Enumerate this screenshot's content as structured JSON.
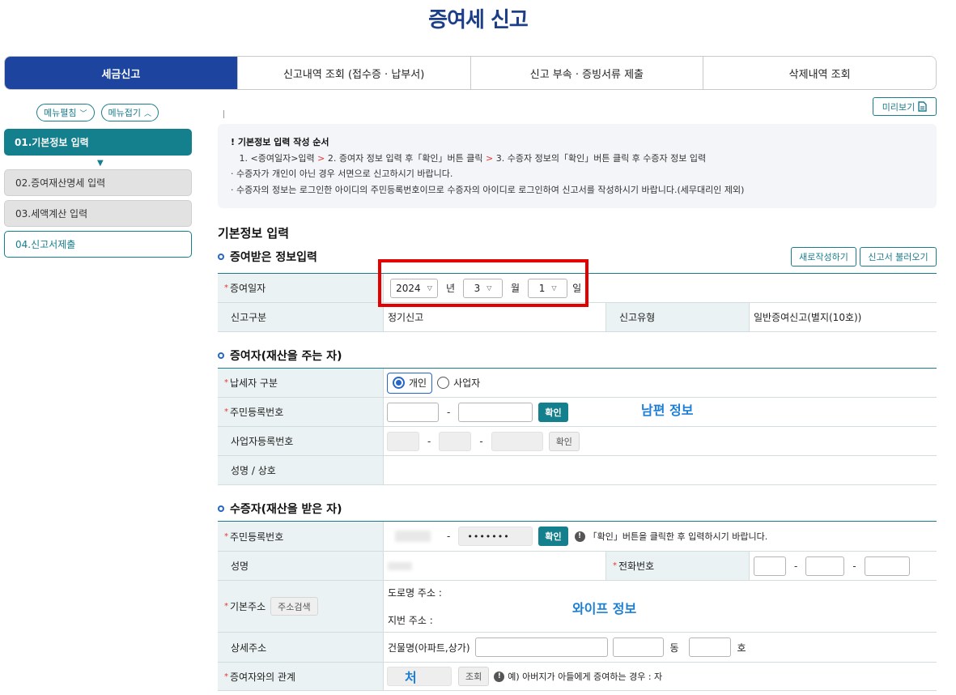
{
  "page_title": "증여세 신고",
  "tabs": [
    "세금신고",
    "신고내역 조회 (접수증 · 납부서)",
    "신고 부속 · 증빙서류 제출",
    "삭제내역 조회"
  ],
  "menu_buttons": {
    "expand": "메뉴펼침",
    "collapse": "메뉴접기"
  },
  "sidebar": {
    "items": [
      {
        "label": "01.기본정보 입력",
        "state": "active"
      },
      {
        "label": "02.증여재산명세 입력",
        "state": "inactive"
      },
      {
        "label": "03.세액계산 입력",
        "state": "inactive"
      },
      {
        "label": "04.신고서제출",
        "state": "inactive"
      }
    ]
  },
  "preview_button": "미리보기",
  "notice": {
    "title": "! 기본정보 입력 작성 순서",
    "step1": "1. <증여일자>입력",
    "arrow": ">",
    "step2": "2. 증여자 정보 입력 후「확인」버튼 클릭",
    "step3": "3. 수증자 정보의「확인」버튼 클릭 후 수증자 정보 입력",
    "line2": "· 수증자가 개인이 아닌 경우 서면으로 신고하시기 바랍니다.",
    "line3": "· 수증자의 정보는 로그인한 아이디의 주민등록번호이므로 수증자의 아이디로 로그인하여 신고서를 작성하시기 바랍니다.(세무대리인 제외)"
  },
  "section_title": "기본정보 입력",
  "gift_info": {
    "subtitle": "증여받은 정보입력",
    "new_button": "새로작성하기",
    "load_button": "신고서 불러오기",
    "date_label": "증여일자",
    "year": "2024",
    "year_unit": "년",
    "month": "3",
    "month_unit": "월",
    "day": "1",
    "day_unit": "일",
    "report_type_label": "신고구분",
    "report_type_value": "정기신고",
    "report_kind_label": "신고유형",
    "report_kind_value": "일반증여신고(별지(10호))"
  },
  "donor": {
    "subtitle": "증여자(재산을 주는 자)",
    "taxpayer_type_label": "납세자 구분",
    "option_individual": "개인",
    "option_business": "사업자",
    "rrn_label": "주민등록번호",
    "confirm": "확인",
    "biz_no_label": "사업자등록번호",
    "name_label": "성명 / 상호",
    "annotation": "남편 정보"
  },
  "donee": {
    "subtitle": "수증자(재산을 받은 자)",
    "rrn_label": "주민등록번호",
    "rrn_back": "•••••••",
    "confirm": "확인",
    "confirm_hint": "「확인」버튼을 클릭한 후 입력하시기 바랍니다.",
    "name_label": "성명",
    "phone_label": "전화번호",
    "address_label": "기본주소",
    "address_search": "주소검색",
    "road_address": "도로명 주소 :",
    "lot_address": "지번 주소 :",
    "detail_label": "상세주소",
    "building_label": "건물명(아파트,상가)",
    "dong": "동",
    "ho": "호",
    "relation_label": "증여자와의 관계",
    "relation_value": "처",
    "lookup": "조회",
    "relation_hint": "예) 아버지가 아들에게 증여하는 경우 : 자",
    "annotation": "와이프 정보"
  },
  "colors": {
    "primary": "#1d45a0",
    "teal": "#147f8d",
    "highlight": "#e50000",
    "annotation": "#1c7fd6"
  }
}
